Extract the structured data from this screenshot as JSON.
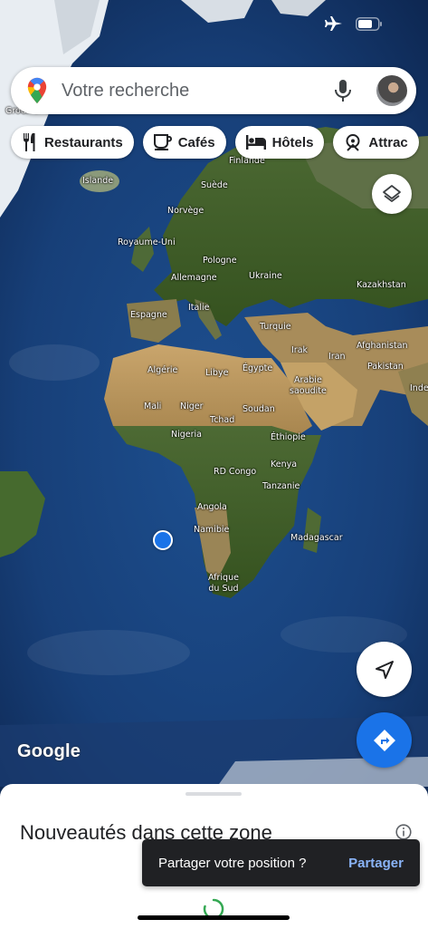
{
  "status_bar": {
    "airplane_icon": "airplane-icon",
    "battery_icon": "battery-icon"
  },
  "search": {
    "placeholder": "Votre recherche"
  },
  "chips": [
    {
      "label": "Restaurants",
      "icon": "fork-knife-icon"
    },
    {
      "label": "Cafés",
      "icon": "coffee-cup-icon"
    },
    {
      "label": "Hôtels",
      "icon": "bed-icon"
    },
    {
      "label": "Attrac",
      "icon": "attraction-icon"
    }
  ],
  "map": {
    "labels": {
      "groenland": "Groenland",
      "finlande": "Finlande",
      "islande": "Islande",
      "suede": "Suède",
      "norvege": "Norvège",
      "royaume_uni": "Royaume-Uni",
      "pologne": "Pologne",
      "allemagne": "Allemagne",
      "ukraine": "Ukraine",
      "kazakhstan": "Kazakhstan",
      "espagne": "Espagne",
      "italie": "Italie",
      "turquie": "Turquie",
      "irak": "Irak",
      "iran": "Iran",
      "afghanistan": "Afghanistan",
      "pakistan": "Pakistan",
      "algerie": "Algérie",
      "libye": "Libye",
      "egypte": "Égypte",
      "arabie": "Arabie\nsaoudite",
      "inde": "Inde",
      "mali": "Mali",
      "niger": "Niger",
      "tchad": "Tchad",
      "soudan": "Soudan",
      "nigeria": "Nigeria",
      "ethiopie": "Éthiopie",
      "rd_congo": "RD Congo",
      "kenya": "Kenya",
      "tanzanie": "Tanzanie",
      "angola": "Angola",
      "namibie": "Namibie",
      "madagascar": "Madagascar",
      "afrique_du_sud": "Afrique\ndu Sud"
    },
    "logo": "Google",
    "accent_color": "#1a73e8"
  },
  "sheet": {
    "title": "Nouveautés dans cette zone"
  },
  "snackbar": {
    "message": "Partager votre position ?",
    "action": "Partager"
  }
}
